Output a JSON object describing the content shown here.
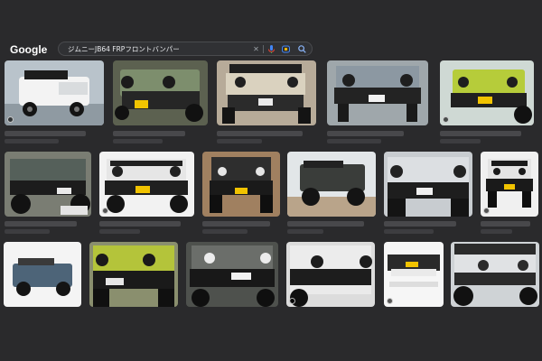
{
  "header": {
    "logo_text": "Google",
    "search_query": "ジムニーJB64 FRPフロントバンパー"
  },
  "icons": [
    "close-icon",
    "mic-icon",
    "camera-lens-icon",
    "search-icon"
  ],
  "results": [
    {
      "row": 1,
      "subject": "white-jimny-side",
      "colors": [
        "#cfd3d6",
        "#ffffff"
      ]
    },
    {
      "row": 1,
      "subject": "green-jimny-bumper",
      "colors": [
        "#7a8a6a",
        "#2a2a2a"
      ]
    },
    {
      "row": 1,
      "subject": "beige-jimny-front",
      "colors": [
        "#d8d0bc",
        "#2f2f2f"
      ]
    },
    {
      "row": 1,
      "subject": "grey-jimny-front",
      "colors": [
        "#8c98a2",
        "#222222"
      ]
    },
    {
      "row": 1,
      "subject": "yellow-green-jimny",
      "colors": [
        "#b6cc3a",
        "#222222"
      ]
    },
    {
      "row": 2,
      "subject": "dark-green-jimny",
      "colors": [
        "#55605a",
        "#1c1c1c"
      ]
    },
    {
      "row": 2,
      "subject": "white-jimny-front",
      "colors": [
        "#e6e6e6",
        "#202020"
      ]
    },
    {
      "row": 2,
      "subject": "black-jimny-front",
      "colors": [
        "#2e2e2e",
        "#a08060"
      ]
    },
    {
      "row": 2,
      "subject": "dark-jimny-offroad",
      "colors": [
        "#3a3d3a",
        "#e2e6e8"
      ]
    },
    {
      "row": 2,
      "subject": "silver-jimny-bumper",
      "colors": [
        "#dcdfe2",
        "#1e1e1e"
      ]
    },
    {
      "row": 2,
      "subject": "white-jimny-studio",
      "colors": [
        "#f0f0f0",
        "#1a1a1a"
      ]
    },
    {
      "row": 3,
      "subject": "blue-jimny-side",
      "colors": [
        "#f4f4f4",
        "#4d6478"
      ]
    },
    {
      "row": 3,
      "subject": "lime-jimny-front",
      "colors": [
        "#b4c43a",
        "#1a1a1a"
      ]
    },
    {
      "row": 3,
      "subject": "grey-jimny-bumper",
      "colors": [
        "#6b6e6a",
        "#181818"
      ]
    },
    {
      "row": 3,
      "subject": "white-jimny-closeup",
      "colors": [
        "#ececec",
        "#1d1d1d"
      ]
    },
    {
      "row": 3,
      "subject": "bumper-part",
      "colors": [
        "#f6f6f6",
        "#2a2a2a"
      ]
    },
    {
      "row": 3,
      "subject": "white-jimny-angle",
      "colors": [
        "#e0e2e4",
        "#2b2b2b"
      ]
    }
  ]
}
